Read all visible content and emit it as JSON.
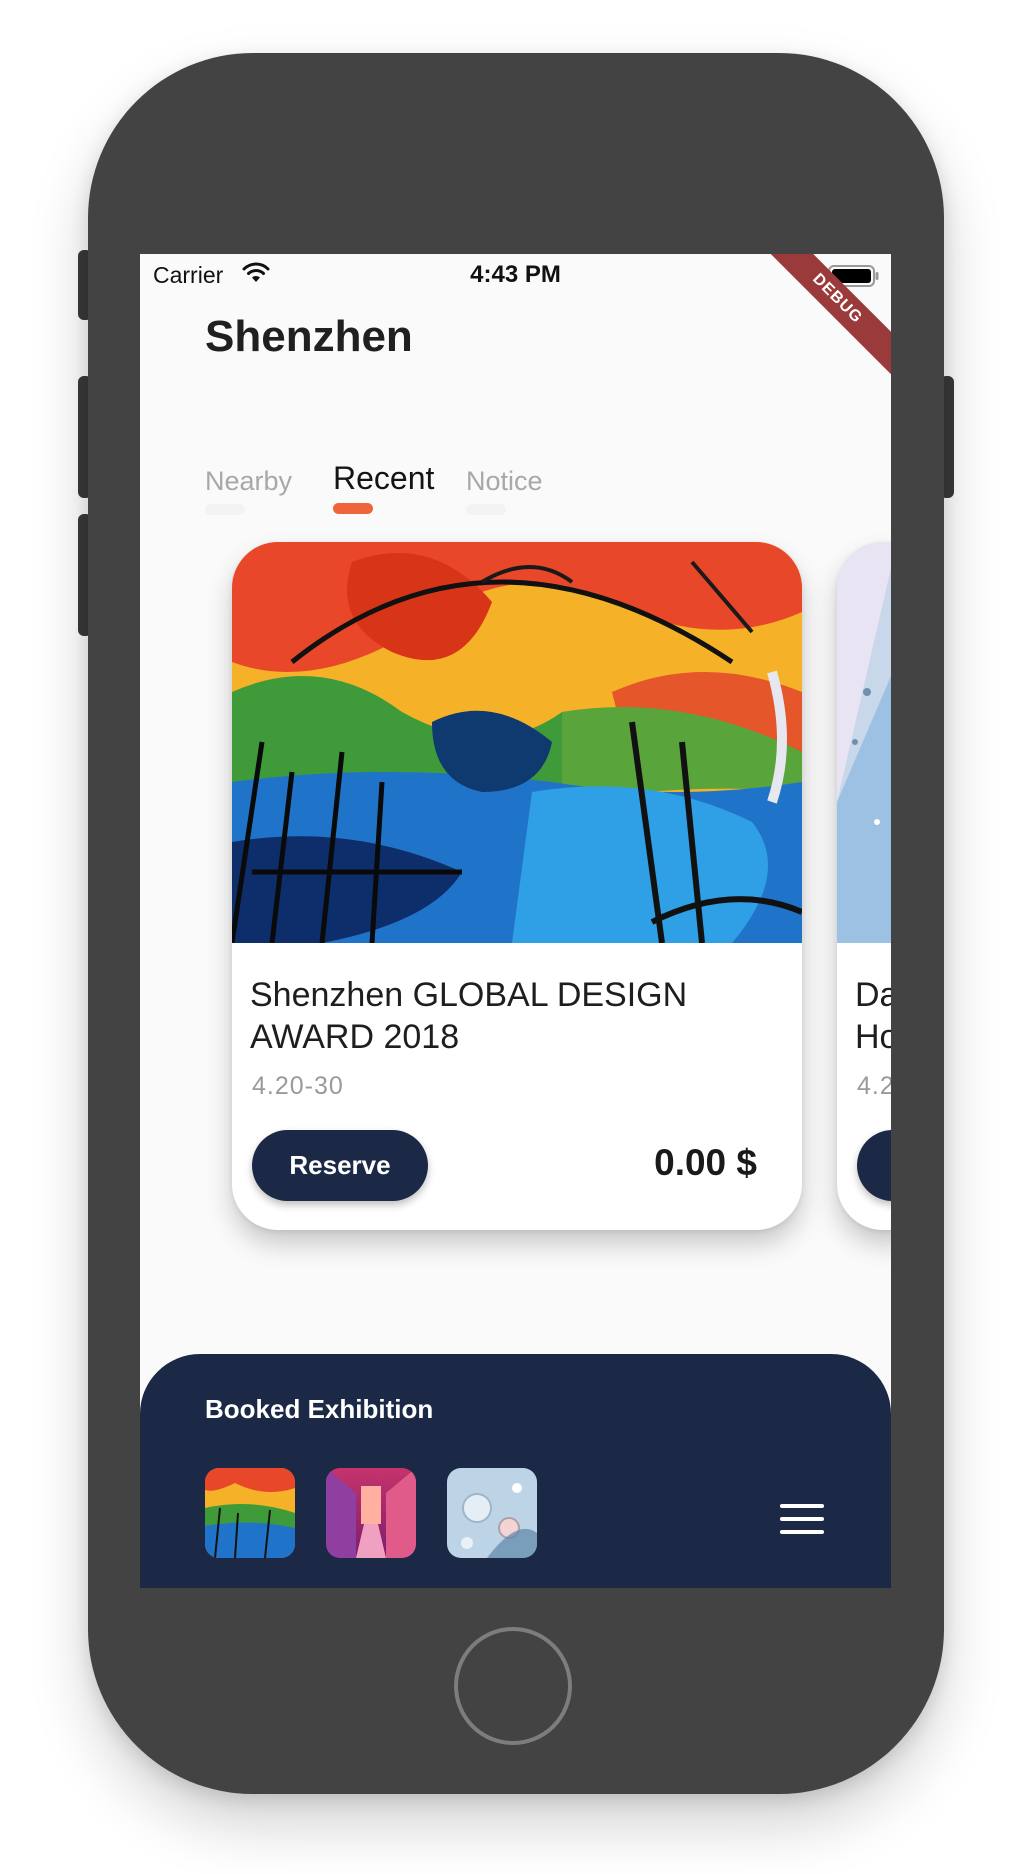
{
  "status_bar": {
    "carrier": "Carrier",
    "time": "4:43 PM"
  },
  "debug_banner": "DEBUG",
  "header": {
    "city": "Shenzhen"
  },
  "tabs": [
    {
      "label": "Nearby",
      "active": false
    },
    {
      "label": "Recent",
      "active": true
    },
    {
      "label": "Notice",
      "active": false
    }
  ],
  "cards": [
    {
      "title": "Shenzhen GLOBAL DESIGN AWARD 2018",
      "date": "4.20-30",
      "button_label": "Reserve",
      "price": "0.00 $",
      "image": "abstract-painting"
    },
    {
      "title": "Da\nHo",
      "date": "4.2",
      "image": "water-drops"
    }
  ],
  "booked": {
    "title": "Booked Exhibition",
    "thumbnails": [
      "abstract-painting",
      "pink-corridor",
      "water-drops"
    ]
  },
  "icons": {
    "wifi": "wifi-icon",
    "battery": "battery-icon",
    "menu": "hamburger-menu-icon",
    "home": "home-button"
  },
  "colors": {
    "navy": "#1c2946",
    "accent": "#f0643c",
    "device": "#434343",
    "debug": "#9b3a3a"
  }
}
